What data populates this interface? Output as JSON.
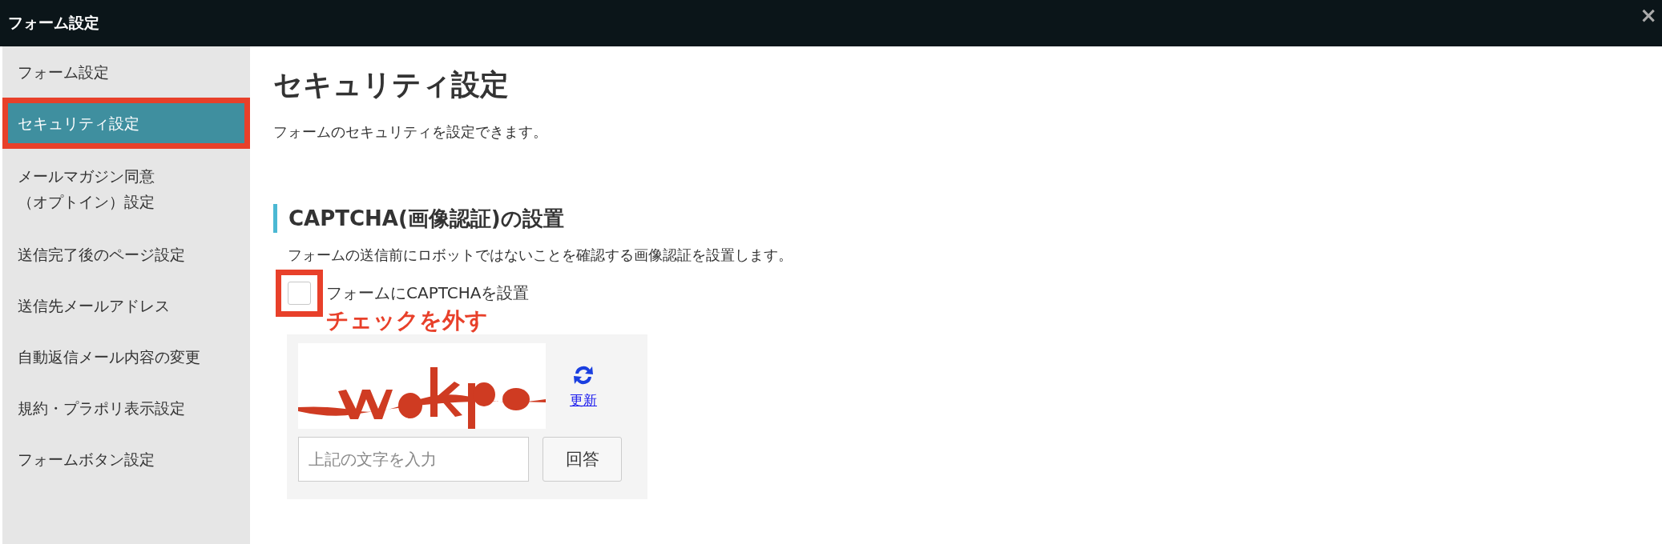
{
  "window": {
    "title": "フォーム設定",
    "close": "×"
  },
  "sidebar": {
    "items": [
      {
        "label": "フォーム設定",
        "selected": false,
        "highlighted": false
      },
      {
        "label": "セキュリティ設定",
        "selected": true,
        "highlighted": true
      },
      {
        "label": "メールマガジン同意（オプトイン）設定",
        "selected": false,
        "highlighted": false
      },
      {
        "label": "送信完了後のページ設定",
        "selected": false,
        "highlighted": false
      },
      {
        "label": "送信先メールアドレス",
        "selected": false,
        "highlighted": false
      },
      {
        "label": "自動返信メール内容の変更",
        "selected": false,
        "highlighted": false
      },
      {
        "label": "規約・プラポリ表示設定",
        "selected": false,
        "highlighted": false
      },
      {
        "label": "フォームボタン設定",
        "selected": false,
        "highlighted": false
      }
    ]
  },
  "main": {
    "title": "セキュリティ設定",
    "description": "フォームのセキュリティを設定できます。",
    "section": {
      "heading": "CAPTCHA(画像認証)の設置",
      "description": "フォームの送信前にロボットではないことを確認する画像認証を設置します。",
      "checkbox": {
        "label": "フォームにCAPTCHAを設置",
        "checked": false,
        "highlighted": true
      },
      "annotation": "チェックを外す",
      "captcha": {
        "refresh_link": "更新",
        "input": {
          "placeholder": "上記の文字を入力"
        },
        "submit_button": "回答"
      }
    }
  }
}
